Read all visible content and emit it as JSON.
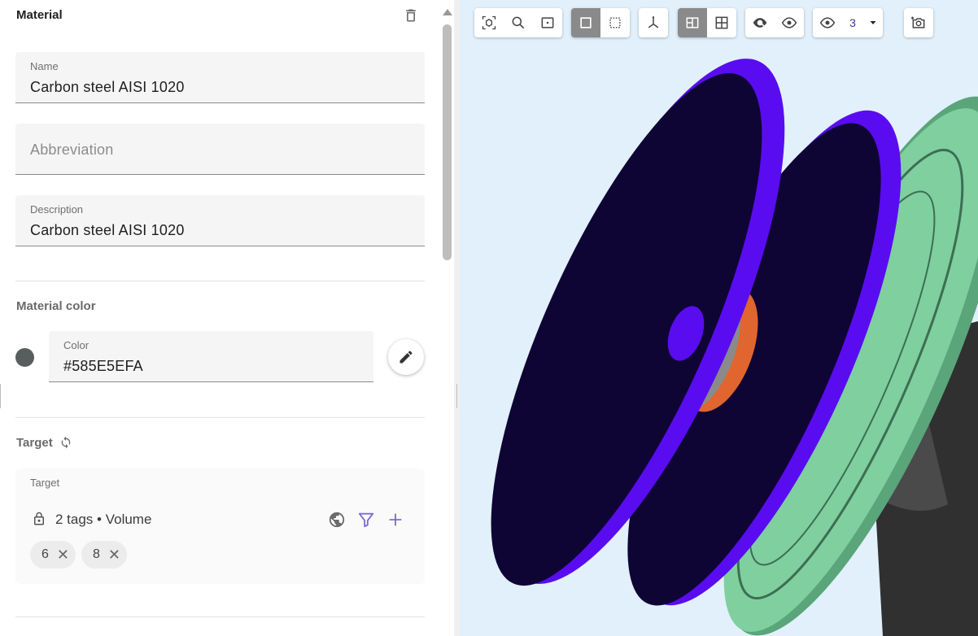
{
  "panel": {
    "title": "Material",
    "name_field": {
      "label": "Name",
      "value": "Carbon steel AISI 1020"
    },
    "abbreviation_field": {
      "placeholder": "Abbreviation",
      "value": ""
    },
    "description_field": {
      "label": "Description",
      "value": "Carbon steel AISI 1020"
    },
    "material_color": {
      "title": "Material color",
      "color_label": "Color",
      "color_value": "#585E5EFA",
      "swatch_hex": "#585E5E"
    },
    "target": {
      "title": "Target",
      "card_label": "Target",
      "summary": "2 tags • Volume",
      "chips": [
        {
          "label": "6"
        },
        {
          "label": "8"
        }
      ]
    }
  },
  "toolbar": {
    "visibility_count": "3"
  },
  "colors": {
    "accent": "#7b6cd9",
    "disc_purple": "#5a0cf0",
    "disc_dark": "#0e0535",
    "green_part": "#7fcf9f",
    "orange_ring": "#e0652e",
    "gray_part": "#4d4d4d",
    "viewport_bg": "#e1f0fb"
  }
}
